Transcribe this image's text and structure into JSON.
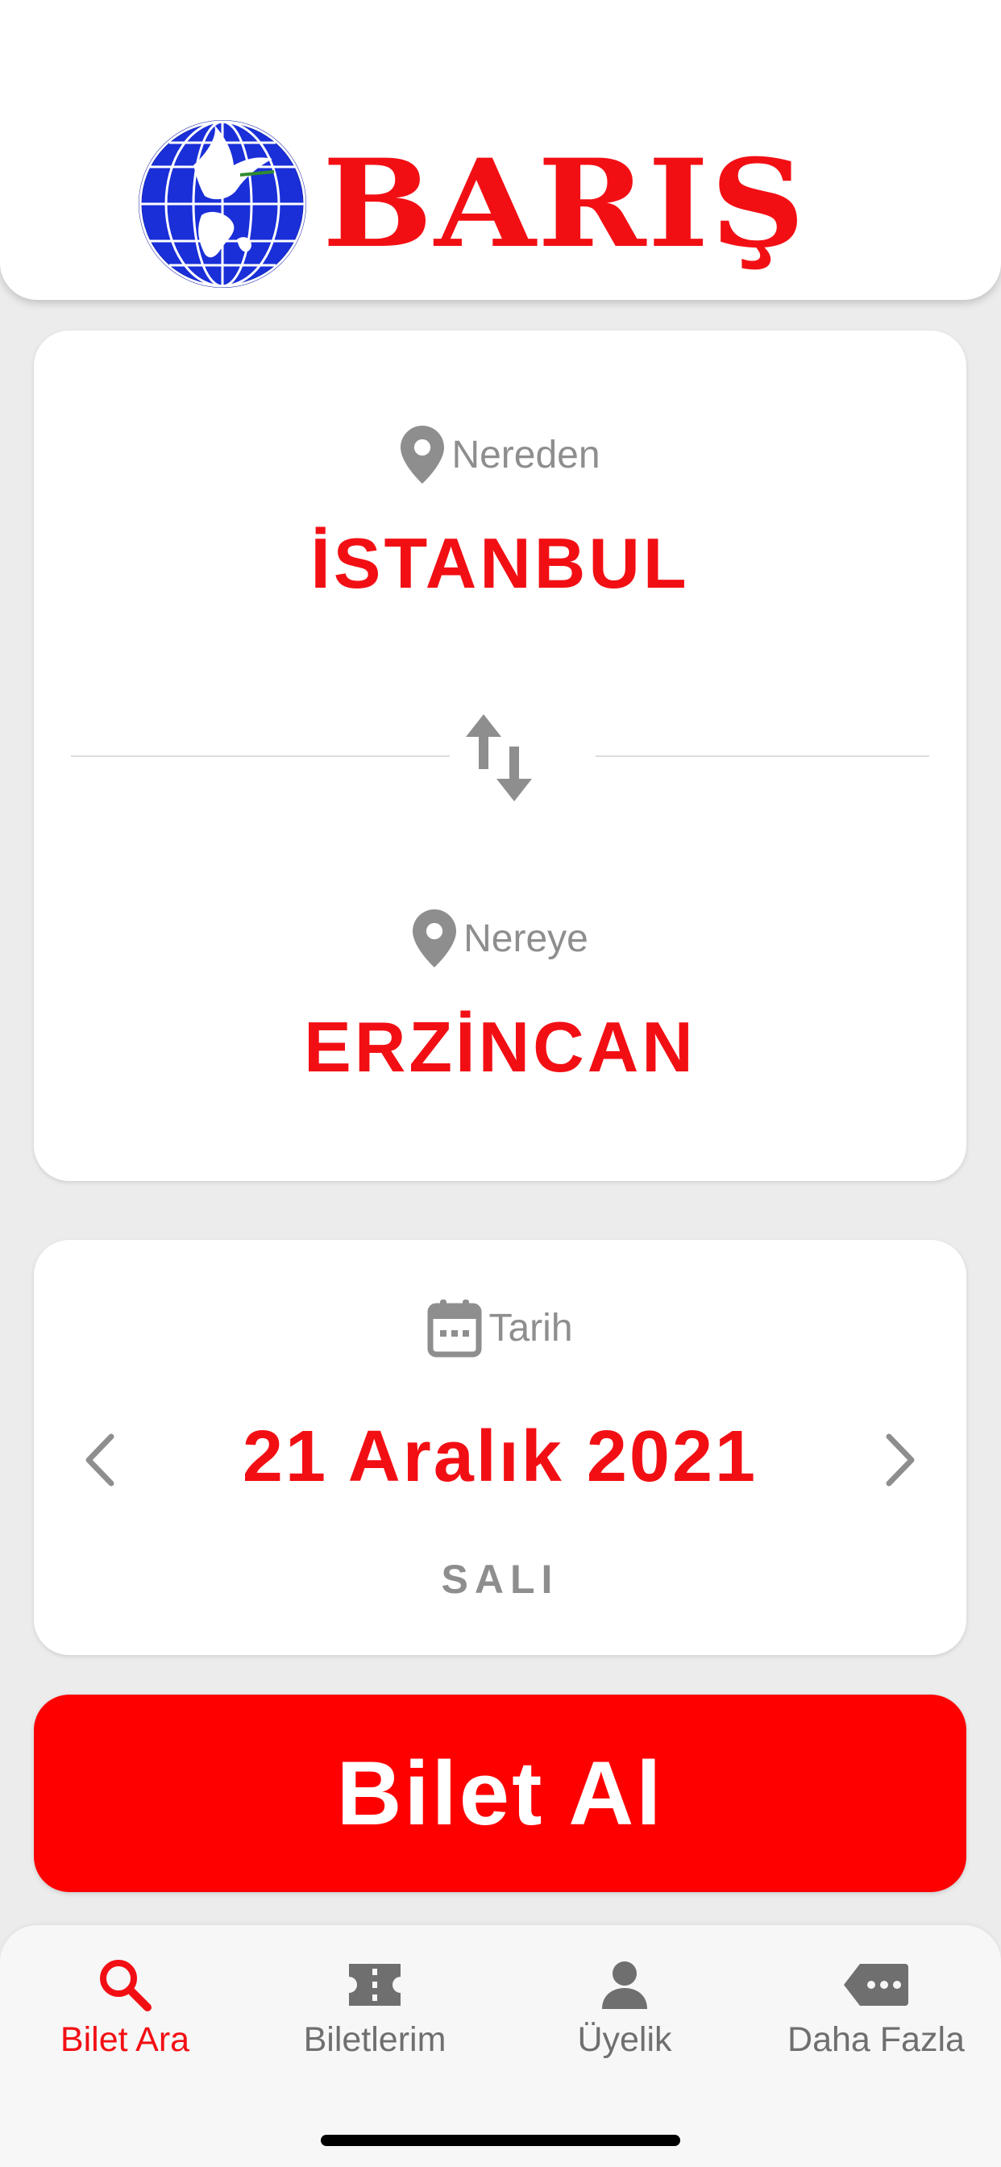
{
  "brand": {
    "name": "BARIŞ",
    "color": "#f20f14",
    "logo_icon": "globe-dove-icon"
  },
  "route": {
    "from_label": "Nereden",
    "from_city": "İSTANBUL",
    "to_label": "Nereye",
    "to_city": "ERZİNCAN",
    "location_icon": "location-pin-icon",
    "swap_icon": "swap-vertical-icon"
  },
  "date": {
    "label": "Tarih",
    "value": "21 Aralık 2021",
    "weekday": "SALI",
    "calendar_icon": "calendar-icon",
    "prev_icon": "chevron-left-icon",
    "next_icon": "chevron-right-icon"
  },
  "actions": {
    "buy_label": "Bilet Al",
    "buy_color": "#ff0000"
  },
  "tabbar": {
    "active_color": "#f20f14",
    "inactive_color": "#6f6f6f",
    "tabs": [
      {
        "label": "Bilet Ara",
        "icon": "search-icon",
        "active": true
      },
      {
        "label": "Biletlerim",
        "icon": "ticket-icon",
        "active": false
      },
      {
        "label": "Üyelik",
        "icon": "person-icon",
        "active": false
      },
      {
        "label": "Daha Fazla",
        "icon": "more-tag-icon",
        "active": false
      }
    ]
  }
}
